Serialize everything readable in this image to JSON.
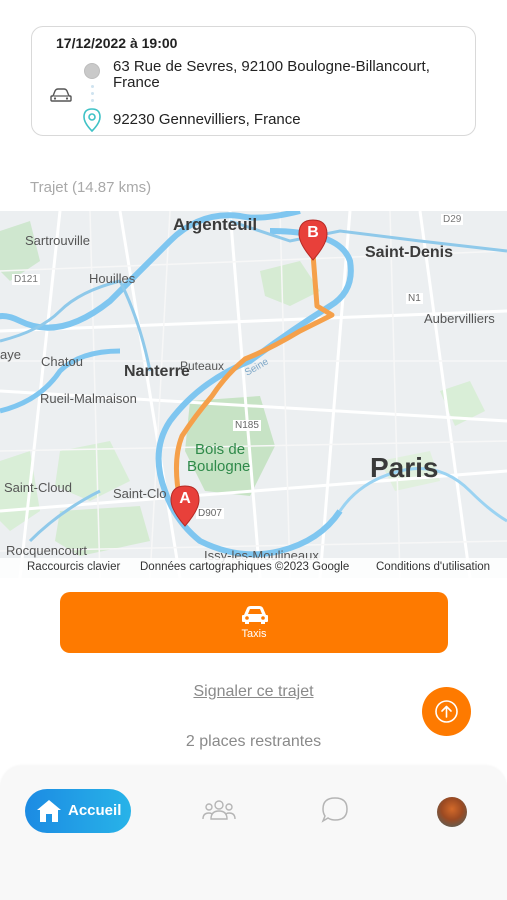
{
  "trip": {
    "datetime": "17/12/2022 à 19:00",
    "origin": "63 Rue de Sevres, 92100 Boulogne-Billancourt, France",
    "destination": "92230 Gennevilliers, France"
  },
  "trajet_label": "Trajet (14.87 kms)",
  "map": {
    "labels": {
      "argenteuil": "Argenteuil",
      "sartrouville": "Sartrouville",
      "houilles": "Houilles",
      "d121": "D121",
      "saint_denis": "Saint-Denis",
      "d29": "D29",
      "n1": "N1",
      "aubervilliers": "Aubervilliers",
      "chatou": "Chatou",
      "nanterre": "Nanterre",
      "puteaux": "Puteaux",
      "rueil": "Rueil-Malmaison",
      "n185": "N185",
      "bois": "Bois de",
      "boulogne": "Boulogne",
      "paris": "Paris",
      "saint_cloud": "Saint-Cloud",
      "saint_clo": "Saint-Clo",
      "d907": "D907",
      "rocquencourt": "Rocquencourt",
      "issy": "Issy-les-Moulineaux",
      "yaye": "aye",
      "seine": "Seine"
    },
    "marker_a": "A",
    "marker_b": "B",
    "footer": {
      "shortcuts": "Raccourcis clavier",
      "data": "Données cartographiques ©2023 Google",
      "terms": "Conditions d'utilisation"
    },
    "route_color": "#f5a04a",
    "marker_color": "#e8403a"
  },
  "taxi_button": {
    "label": "Taxis",
    "icon": "car-icon"
  },
  "report_link": "Signaler ce trajet",
  "places_text": "2 places restrantes",
  "scroll_top_icon": "arrow-up-circle-icon",
  "nav": {
    "home_label": "Accueil",
    "items": [
      "home-icon",
      "users-icon",
      "chat-icon",
      "avatar"
    ]
  },
  "colors": {
    "accent": "#fe7a00",
    "nav_active": "#1c8be3"
  }
}
